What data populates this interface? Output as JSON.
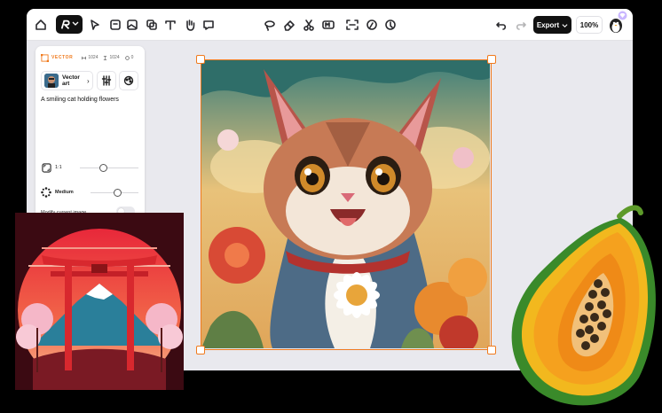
{
  "toolbar": {
    "tools": [
      "home-icon",
      "cursor-icon",
      "frame-icon",
      "image-icon",
      "layers-icon",
      "text-icon",
      "hand-icon",
      "chat-icon"
    ],
    "center_tools": [
      "lasso-icon",
      "eraser-icon",
      "scissors-icon",
      "enhance-icon",
      "expand-icon",
      "paint-icon",
      "magic-icon"
    ],
    "export_label": "Export",
    "zoom": "100%"
  },
  "panel": {
    "mode": "VECTOR",
    "width": "1024",
    "height": "1024",
    "count": "0",
    "style_name": "Vector art",
    "prompt": "A smiling cat holding flowers",
    "aspect_label": "1:1",
    "detail_label": "Medium",
    "modify_label": "Modify current image"
  },
  "colors": {
    "accent": "#f07a1d",
    "dark": "#111111",
    "canvas_bg": "#e9e9ee"
  }
}
